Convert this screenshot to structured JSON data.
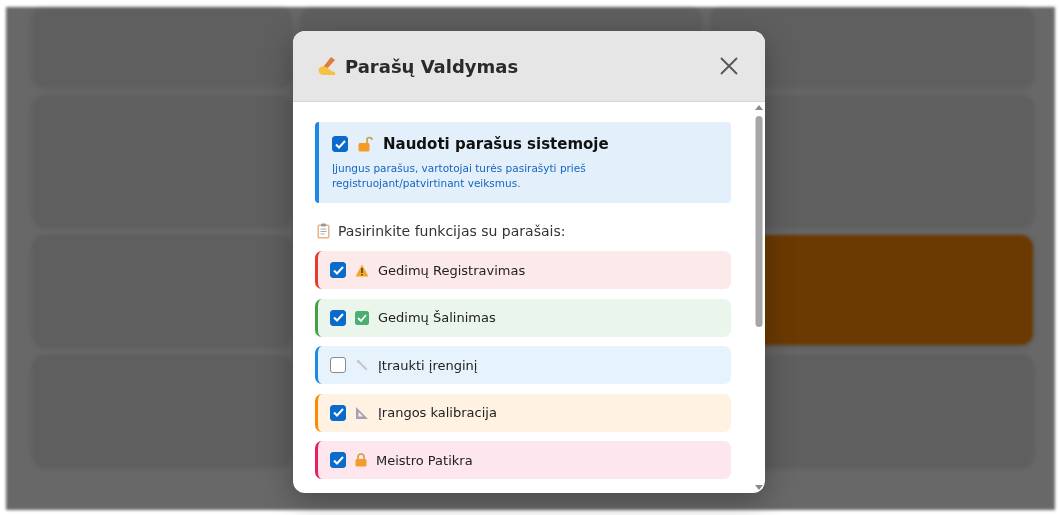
{
  "dialog": {
    "title": "Parašų Valdymas",
    "master": {
      "label": "Naudoti parašus sistemoje",
      "checked": true,
      "hint": "Įjungus parašus, vartotojai turės pasirašyti prieš registruojant/patvirtinant veiksmus."
    },
    "section_title": "Pasirinkite funkcijas su parašais:",
    "functions": [
      {
        "label": "Gedimų Registravimas",
        "checked": true,
        "color": "#e53935"
      },
      {
        "label": "Gedimų Šalinimas",
        "checked": true,
        "color": "#43a047"
      },
      {
        "label": "Įtraukti įrenginį",
        "checked": false,
        "color": "#1e88e5"
      },
      {
        "label": "Įrangos kalibracija",
        "checked": true,
        "color": "#fb8c00"
      },
      {
        "label": "Meistro Patikra",
        "checked": true,
        "color": "#e91e63"
      }
    ]
  }
}
